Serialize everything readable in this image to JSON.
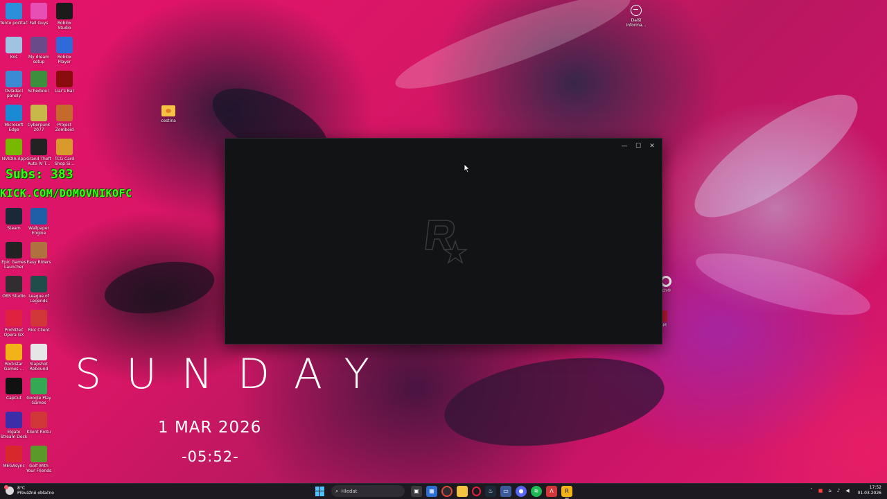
{
  "overlay": {
    "subs": "Subs: 383",
    "kick": "KICK.COM/DOMOVNIKOFC"
  },
  "desktop_date": {
    "day": "SUNDAY",
    "date": "1 MAR 2026",
    "time": "-05:52-"
  },
  "desktop_icons": [
    {
      "label": "Tento počítač",
      "icon": "computer-icon",
      "color": "#2b8fd9"
    },
    {
      "label": "Fall Guys",
      "icon": "fall-guys-icon",
      "color": "#e84fb4"
    },
    {
      "label": "Roblox Studio",
      "icon": "roblox-studio-icon",
      "color": "#1b1b1b"
    },
    {
      "label": "Koš",
      "icon": "recycle-bin-icon",
      "color": "#9fc3e0"
    },
    {
      "label": "My dream setup",
      "icon": "my-dream-setup-icon",
      "color": "#6b4a8a"
    },
    {
      "label": "Roblox Player",
      "icon": "roblox-player-icon",
      "color": "#2f6bd8"
    },
    {
      "label": "Ovládací panely",
      "icon": "control-panel-icon",
      "color": "#3a8bd1"
    },
    {
      "label": "Schedule I",
      "icon": "schedule-icon",
      "color": "#3c8f3c"
    },
    {
      "label": "Liar's Bar",
      "icon": "liars-bar-icon",
      "color": "#8a0d0d"
    },
    {
      "label": "Microsoft Edge",
      "icon": "edge-icon",
      "color": "#1a8ad4"
    },
    {
      "label": "Cyberpunk 2077",
      "icon": "cyberpunk-icon",
      "color": "#c8b84a"
    },
    {
      "label": "Project Zomboid",
      "icon": "project-zomboid-icon",
      "color": "#c46a2a"
    },
    {
      "label": "NVIDIA App",
      "icon": "nvidia-icon",
      "color": "#76b900"
    },
    {
      "label": "Grand Theft Auto IV T...",
      "icon": "gta-iv-icon",
      "color": "#222222"
    },
    {
      "label": "TCG Card Shop Si...",
      "icon": "tcg-card-shop-icon",
      "color": "#d89a2a"
    },
    {
      "label": "Steam",
      "icon": "steam-icon",
      "color": "#1b2838"
    },
    {
      "label": "Wallpaper Engine",
      "icon": "wallpaper-engine-icon",
      "color": "#1f5fa8"
    },
    {
      "label": "Epic Games Launcher",
      "icon": "epic-games-icon",
      "color": "#222222"
    },
    {
      "label": "Easy Riders",
      "icon": "easy-riders-icon",
      "color": "#b07040"
    },
    {
      "label": "OBS Studio",
      "icon": "obs-icon",
      "color": "#302e31"
    },
    {
      "label": "League of Legends",
      "icon": "league-of-legends-icon",
      "color": "#1f4d4a"
    },
    {
      "label": "Prohlížeč Opera GX",
      "icon": "opera-gx-icon",
      "color": "#e0213f"
    },
    {
      "label": "Riot Client",
      "icon": "riot-client-icon",
      "color": "#d13639"
    },
    {
      "label": "Rockstar Games ...",
      "icon": "rockstar-icon",
      "color": "#f2b318"
    },
    {
      "label": "Slapshot Rebound",
      "icon": "slapshot-icon",
      "color": "#e6e6e6"
    },
    {
      "label": "CapCut",
      "icon": "capcut-icon",
      "color": "#111111"
    },
    {
      "label": "Google Play Games",
      "icon": "google-play-games-icon",
      "color": "#34a853"
    },
    {
      "label": "Elgato Stream Deck",
      "icon": "stream-deck-icon",
      "color": "#3a2fa8"
    },
    {
      "label": "Klient Riotu",
      "icon": "riot-client-icon",
      "color": "#d13639"
    },
    {
      "label": "MEGAsync",
      "icon": "mega-icon",
      "color": "#d9272e"
    },
    {
      "label": "Golf With Your Friends",
      "icon": "golf-icon",
      "color": "#5a9a2a"
    }
  ],
  "folder": {
    "label": "cestina"
  },
  "top_right_icon": {
    "label": "Další informa..."
  },
  "right_partial": {
    "label1": "tch®",
    "label2": "eM"
  },
  "window": {
    "minimize": "—",
    "maximize": "☐",
    "close": "✕"
  },
  "taskbar": {
    "weather_temp": "8°C",
    "weather_desc": "Převážně oblačno",
    "search_placeholder": "Hledat",
    "time": "17:52",
    "date": "01.03.2026"
  }
}
